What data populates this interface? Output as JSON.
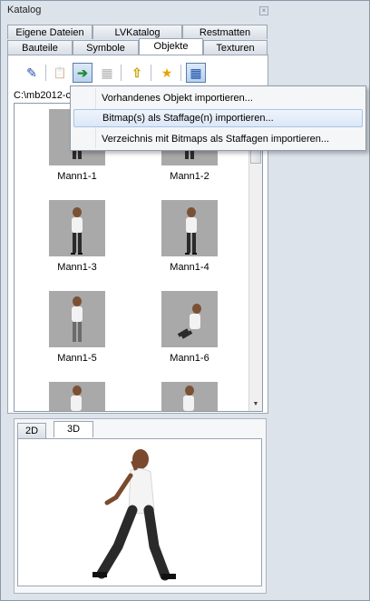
{
  "window": {
    "title": "Katalog",
    "close_glyph": "×"
  },
  "tabs_row1": [
    {
      "label": "Eigene Dateien"
    },
    {
      "label": "LVKatalog"
    },
    {
      "label": "Restmatten"
    }
  ],
  "tabs_row2": [
    {
      "label": "Bauteile"
    },
    {
      "label": "Symbole"
    },
    {
      "label": "Objekte",
      "active": true
    },
    {
      "label": "Texturen"
    }
  ],
  "toolbar": {
    "buttons": [
      {
        "name": "pen-icon",
        "glyph": "✎"
      },
      {
        "name": "paste-icon",
        "glyph": "📋"
      },
      {
        "name": "import-icon",
        "glyph": "➔"
      },
      {
        "name": "properties-icon",
        "glyph": "▦"
      },
      {
        "name": "folder-up-icon",
        "glyph": "⇧"
      },
      {
        "name": "favorite-icon",
        "glyph": "★"
      },
      {
        "name": "view-icon",
        "glyph": "▦"
      }
    ]
  },
  "path": {
    "text": "C:\\mb2012-c"
  },
  "items": [
    {
      "label": "Mann1-1"
    },
    {
      "label": "Mann1-2"
    },
    {
      "label": "Mann1-3"
    },
    {
      "label": "Mann1-4"
    },
    {
      "label": "Mann1-5"
    },
    {
      "label": "Mann1-6"
    },
    {
      "label": ""
    },
    {
      "label": ""
    }
  ],
  "preview_tabs": [
    {
      "label": "2D"
    },
    {
      "label": "3D",
      "active": true
    }
  ],
  "context_menu": {
    "items": [
      {
        "label": "Vorhandenes Objekt importieren..."
      },
      {
        "label": "Bitmap(s) als Staffage(n) importieren...",
        "highlighted": true
      },
      {
        "label": "Verzeichnis mit Bitmaps als Staffagen importieren..."
      }
    ]
  },
  "colors": {
    "panel_bg": "#dde3ea",
    "border": "#8a99ab",
    "highlight": "#dbe7f6",
    "thumb_bg": "#a9a9a9"
  }
}
